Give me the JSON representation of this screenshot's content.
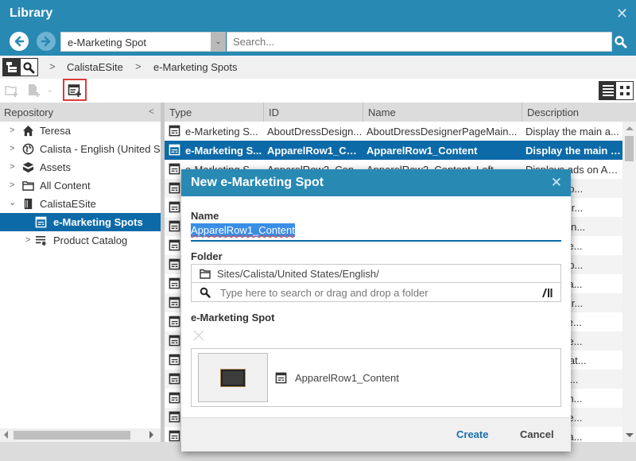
{
  "window": {
    "title": "Library",
    "close_icon": "close-icon"
  },
  "searchbar": {
    "type_filter": "e-Marketing Spot",
    "search_placeholder": "Search...",
    "back_icon": "arrow-left-circle-icon",
    "forward_icon": "arrow-right-circle-icon"
  },
  "breadcrumb": {
    "items": [
      "CalistaESite",
      "e-Marketing Spots"
    ],
    "separator": ">"
  },
  "sidebar": {
    "header": "Repository",
    "collapse_glyph": "<",
    "items": [
      {
        "label": "Teresa",
        "icon": "home-icon",
        "expandable": true,
        "expanded": false,
        "level": 0,
        "selected": false
      },
      {
        "label": "Calista - English (United States)",
        "icon": "site-globe-icon",
        "expandable": true,
        "expanded": false,
        "level": 0,
        "selected": false
      },
      {
        "label": "Assets",
        "icon": "assets-box-icon",
        "expandable": true,
        "expanded": false,
        "level": 0,
        "selected": false
      },
      {
        "label": "All Content",
        "icon": "folder-icon",
        "expandable": true,
        "expanded": false,
        "level": 0,
        "selected": false
      },
      {
        "label": "CalistaESite",
        "icon": "store-icon",
        "expandable": true,
        "expanded": true,
        "level": 0,
        "selected": false
      },
      {
        "label": "e-Marketing Spots",
        "icon": "marketing-spot-icon",
        "expandable": false,
        "expanded": false,
        "level": 1,
        "selected": true
      },
      {
        "label": "Product Catalog",
        "icon": "catalog-icon",
        "expandable": true,
        "expanded": false,
        "level": 1,
        "selected": false
      }
    ]
  },
  "grid": {
    "columns": [
      "Type",
      "ID",
      "Name",
      "Description"
    ],
    "rows": [
      {
        "type": "e-Marketing S...",
        "id": "AboutDressDesign...",
        "name": "AboutDressDesignerPageMain...",
        "description": "Display the main a...",
        "selected": false
      },
      {
        "type": "e-Marketing S...",
        "id": "ApparelRow1_Con...",
        "name": "ApparelRow1_Content",
        "description": "Display the main a...",
        "selected": true
      },
      {
        "type": "e-Marketing S...",
        "id": "ApparelRow2_Con...",
        "name": "ApparelRow2_Content_Left",
        "description": "Displays ads on Ap...",
        "selected": false
      },
      {
        "type": "",
        "id": "",
        "name": "",
        "description": "...ds on Ap...",
        "selected": false
      },
      {
        "type": "",
        "id": "",
        "name": "",
        "description": "...ategory r...",
        "selected": false
      },
      {
        "type": "",
        "id": "",
        "name": "",
        "description": "...atalog en...",
        "selected": false
      },
      {
        "type": "",
        "id": "",
        "name": "",
        "description": "...ecomme...",
        "selected": false
      },
      {
        "type": "",
        "id": "",
        "name": "",
        "description": "...ds on Ap...",
        "selected": false
      },
      {
        "type": "",
        "id": "",
        "name": "",
        "description": "...e main a...",
        "selected": false
      },
      {
        "type": "",
        "id": "",
        "name": "",
        "description": "...ategory r...",
        "selected": false
      },
      {
        "type": "",
        "id": "",
        "name": "",
        "description": "...e bestse...",
        "selected": false
      },
      {
        "type": "",
        "id": "",
        "name": "",
        "description": "...ecomme...",
        "selected": false
      },
      {
        "type": "",
        "id": "",
        "name": "",
        "description": "...ds on Bat...",
        "selected": false
      },
      {
        "type": "",
        "id": "",
        "name": "",
        "description": "...list of th...",
        "selected": false
      },
      {
        "type": "",
        "id": "",
        "name": "",
        "description": "...commen...",
        "selected": false
      },
      {
        "type": "",
        "id": "",
        "name": "",
        "description": "...ecomme...",
        "selected": false
      },
      {
        "type": "",
        "id": "",
        "name": "",
        "description": "...e main a...",
        "selected": false
      }
    ]
  },
  "dialog": {
    "title": "New e-Marketing Spot",
    "name_label": "Name",
    "name_value": "ApparelRow1_Content",
    "folder_label": "Folder",
    "folder_path": "Sites/Calista/United States/English/",
    "folder_search_placeholder": "Type here to search or drag and drop a folder",
    "spot_label": "e-Marketing Spot",
    "spot_value": "ApparelRow1_Content",
    "create_label": "Create",
    "cancel_label": "Cancel"
  },
  "colors": {
    "header_bg": "#2889b3",
    "selection_bg": "#0c6aa8",
    "highlight_border": "#e03a3a",
    "create_text": "#1a6fb0"
  }
}
